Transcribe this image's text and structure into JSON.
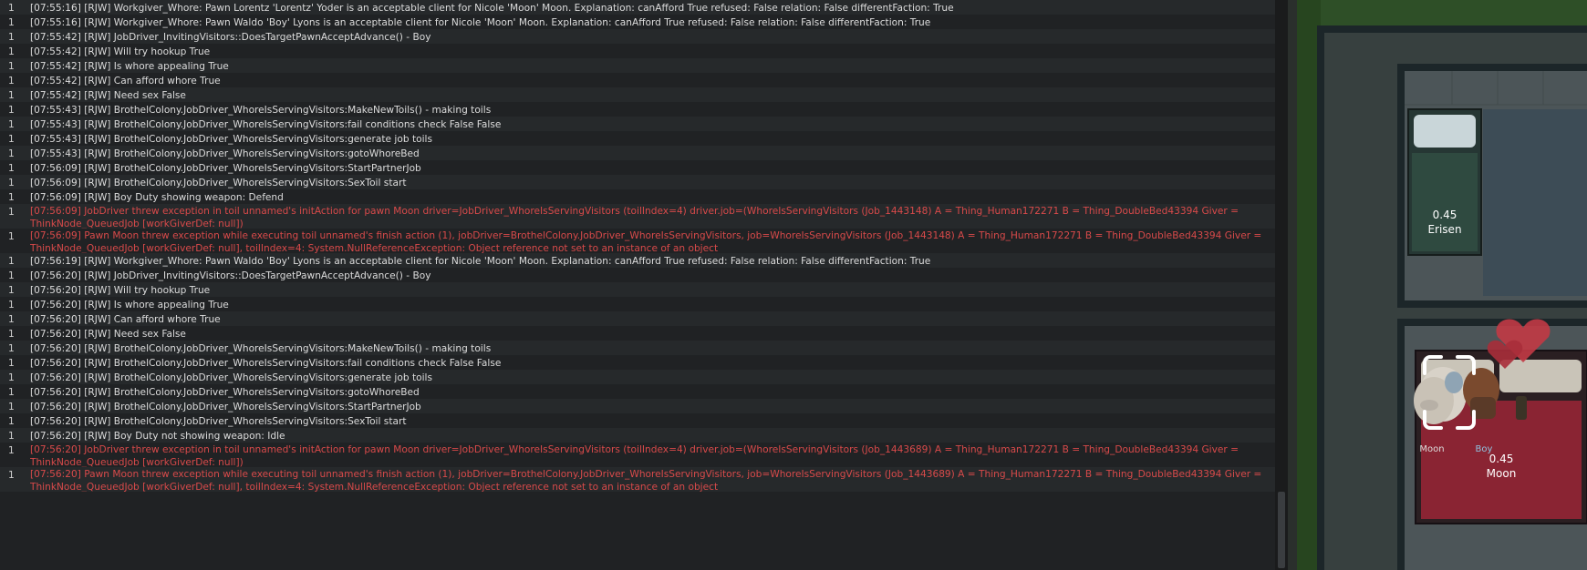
{
  "log": {
    "rows": [
      {
        "count": "1",
        "text": "[07:55:16] [RJW] Workgiver_Whore: Pawn Lorentz 'Lorentz' Yoder is an acceptable client for Nicole 'Moon' Moon. Explanation: canAfford True refused: False relation: False differentFaction: True",
        "type": "normal"
      },
      {
        "count": "1",
        "text": "[07:55:16] [RJW] Workgiver_Whore: Pawn Waldo 'Boy' Lyons is an acceptable client for Nicole 'Moon' Moon. Explanation: canAfford True refused: False relation: False differentFaction: True",
        "type": "normal"
      },
      {
        "count": "1",
        "text": "[07:55:42] [RJW] JobDriver_InvitingVisitors::DoesTargetPawnAcceptAdvance() - Boy",
        "type": "normal"
      },
      {
        "count": "1",
        "text": "[07:55:42] [RJW] Will try hookup True",
        "type": "normal"
      },
      {
        "count": "1",
        "text": "[07:55:42] [RJW] Is whore appealing  True",
        "type": "normal"
      },
      {
        "count": "1",
        "text": "[07:55:42] [RJW] Can afford whore True",
        "type": "normal"
      },
      {
        "count": "1",
        "text": "[07:55:42] [RJW] Need sex False",
        "type": "normal"
      },
      {
        "count": "1",
        "text": "[07:55:43] [RJW] BrothelColony.JobDriver_WhoreIsServingVisitors:MakeNewToils() - making toils",
        "type": "normal"
      },
      {
        "count": "1",
        "text": "[07:55:43] [RJW] BrothelColony.JobDriver_WhoreIsServingVisitors:fail conditions check False False",
        "type": "normal"
      },
      {
        "count": "1",
        "text": "[07:55:43] [RJW] BrothelColony.JobDriver_WhoreIsServingVisitors:generate job toils",
        "type": "normal"
      },
      {
        "count": "1",
        "text": "[07:55:43] [RJW] BrothelColony.JobDriver_WhoreIsServingVisitors:gotoWhoreBed",
        "type": "normal"
      },
      {
        "count": "1",
        "text": "[07:56:09] [RJW] BrothelColony.JobDriver_WhoreIsServingVisitors:StartPartnerJob",
        "type": "normal"
      },
      {
        "count": "1",
        "text": "[07:56:09] [RJW] BrothelColony.JobDriver_WhoreIsServingVisitors:SexToil start",
        "type": "normal"
      },
      {
        "count": "1",
        "text": "[07:56:09] [RJW] Boy Duty showing weapon: Defend",
        "type": "normal"
      },
      {
        "count": "1",
        "text": "[07:56:09] JobDriver threw exception in toil unnamed's initAction for pawn Moon driver=JobDriver_WhoreIsServingVisitors (toilIndex=4) driver.job=(WhoreIsServingVisitors (Job_1443148) A = Thing_Human172271 B = Thing_DoubleBed43394 Giver = ThinkNode_QueuedJob [workGiverDef: null])",
        "type": "error"
      },
      {
        "count": "1",
        "text": "[07:56:09] Pawn Moon threw exception while executing toil unnamed's finish action (1), jobDriver=BrothelColony.JobDriver_WhoreIsServingVisitors, job=WhoreIsServingVisitors (Job_1443148) A = Thing_Human172271 B = Thing_DoubleBed43394 Giver = ThinkNode_QueuedJob [workGiverDef: null], toilIndex=4: System.NullReferenceException: Object reference not set to an instance of an object",
        "type": "error"
      },
      {
        "count": "1",
        "text": "[07:56:19] [RJW] Workgiver_Whore: Pawn Waldo 'Boy' Lyons is an acceptable client for Nicole 'Moon' Moon. Explanation: canAfford True refused: False relation: False differentFaction: True",
        "type": "normal"
      },
      {
        "count": "1",
        "text": "[07:56:20] [RJW] JobDriver_InvitingVisitors::DoesTargetPawnAcceptAdvance() - Boy",
        "type": "normal"
      },
      {
        "count": "1",
        "text": "[07:56:20] [RJW] Will try hookup True",
        "type": "normal"
      },
      {
        "count": "1",
        "text": "[07:56:20] [RJW] Is whore appealing  True",
        "type": "normal"
      },
      {
        "count": "1",
        "text": "[07:56:20] [RJW] Can afford whore True",
        "type": "normal"
      },
      {
        "count": "1",
        "text": "[07:56:20] [RJW] Need sex False",
        "type": "normal"
      },
      {
        "count": "1",
        "text": "[07:56:20] [RJW] BrothelColony.JobDriver_WhoreIsServingVisitors:MakeNewToils() - making toils",
        "type": "normal"
      },
      {
        "count": "1",
        "text": "[07:56:20] [RJW] BrothelColony.JobDriver_WhoreIsServingVisitors:fail conditions check False False",
        "type": "normal"
      },
      {
        "count": "1",
        "text": "[07:56:20] [RJW] BrothelColony.JobDriver_WhoreIsServingVisitors:generate job toils",
        "type": "normal"
      },
      {
        "count": "1",
        "text": "[07:56:20] [RJW] BrothelColony.JobDriver_WhoreIsServingVisitors:gotoWhoreBed",
        "type": "normal"
      },
      {
        "count": "1",
        "text": "[07:56:20] [RJW] BrothelColony.JobDriver_WhoreIsServingVisitors:StartPartnerJob",
        "type": "normal"
      },
      {
        "count": "1",
        "text": "[07:56:20] [RJW] BrothelColony.JobDriver_WhoreIsServingVisitors:SexToil start",
        "type": "normal"
      },
      {
        "count": "1",
        "text": "[07:56:20] [RJW] Boy Duty not showing weapon: Idle",
        "type": "normal"
      },
      {
        "count": "1",
        "text": "[07:56:20] JobDriver threw exception in toil unnamed's initAction for pawn Moon driver=JobDriver_WhoreIsServingVisitors (toilIndex=4) driver.job=(WhoreIsServingVisitors (Job_1443689) A = Thing_Human172271 B = Thing_DoubleBed43394 Giver = ThinkNode_QueuedJob [workGiverDef: null])",
        "type": "error"
      },
      {
        "count": "1",
        "text": "[07:56:20] Pawn Moon threw exception while executing toil unnamed's finish action (1), jobDriver=BrothelColony.JobDriver_WhoreIsServingVisitors, job=WhoreIsServingVisitors (Job_1443689) A = Thing_Human172271 B = Thing_DoubleBed43394 Giver = ThinkNode_QueuedJob [workGiverDef: null], toilIndex=4: System.NullReferenceException: Object reference not set to an instance of an object",
        "type": "error"
      }
    ]
  },
  "world": {
    "bed_top": {
      "value": "0.45",
      "owner": "Erisen"
    },
    "bed_bottom": {
      "value": "0.45",
      "owner": "Moon"
    },
    "pawn_moon_label": "Moon",
    "pawn_boy_label": "Boy",
    "colors": {
      "grass": "#2c4a25",
      "wall": "#1f2a2c",
      "floor": "#4a5356",
      "bed_green": "#2f4a40",
      "bed_red": "#8a2433",
      "heart": "#c23a45",
      "selection": "#ffffff"
    }
  }
}
